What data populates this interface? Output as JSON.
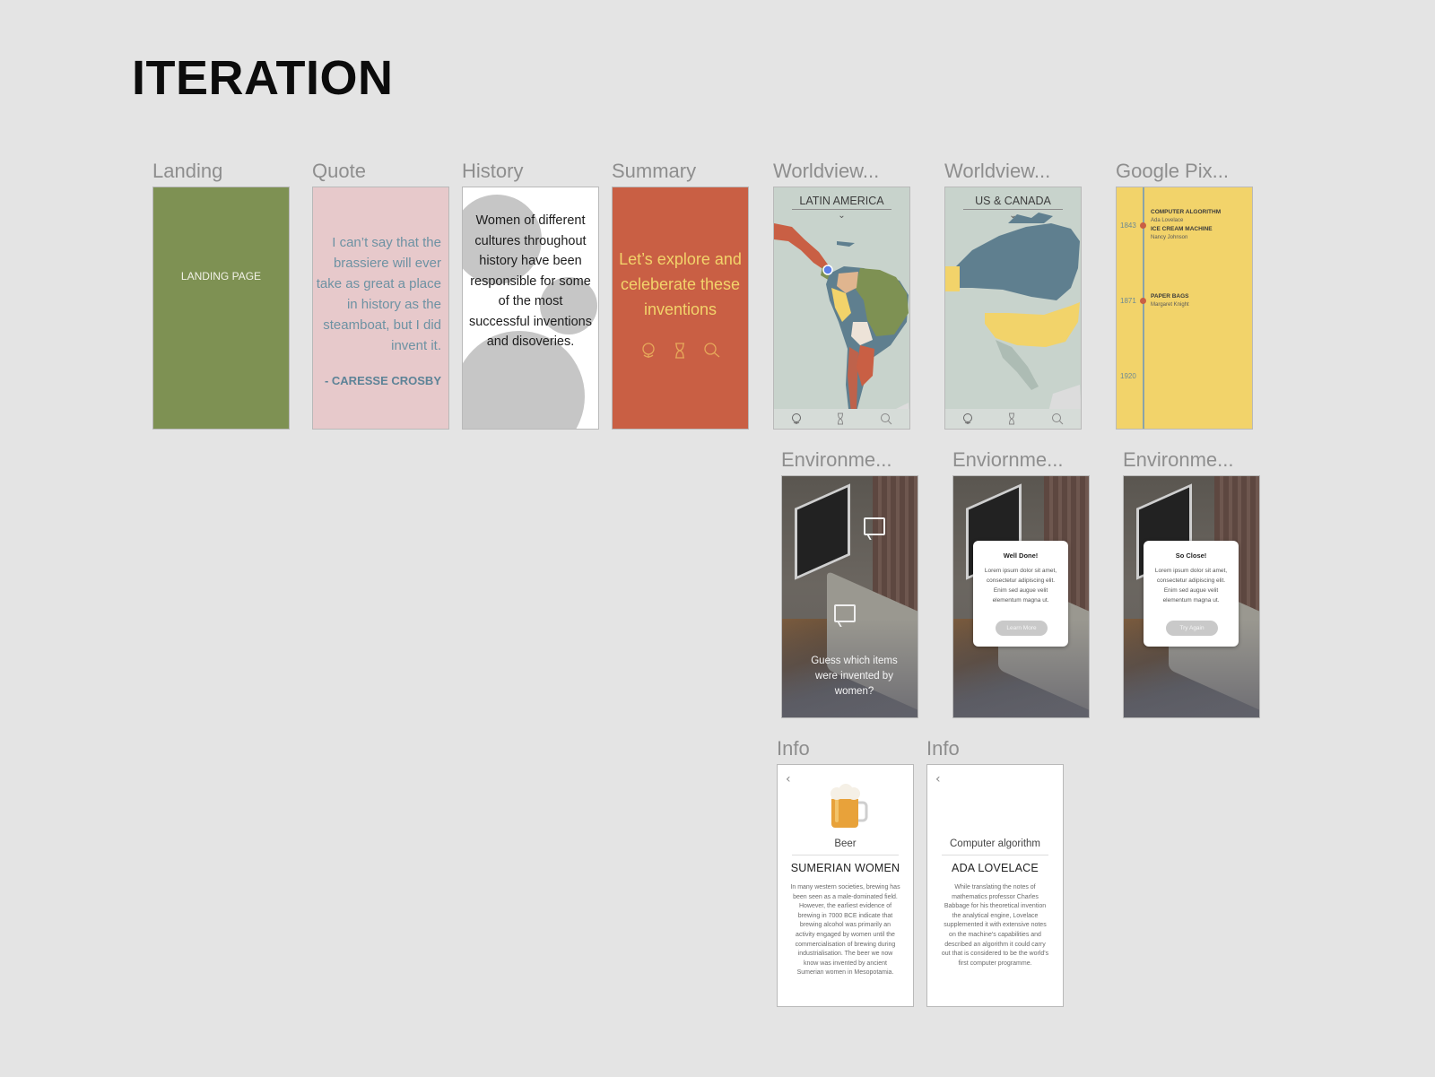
{
  "heading": "ITERATION",
  "frames": {
    "landing": {
      "label": "Landing",
      "text": "LANDING PAGE",
      "color": "#7e9153"
    },
    "quote": {
      "label": "Quote",
      "text": "I can’t say that the brassiere will ever take as great a place in history as the steamboat, but I did invent it.",
      "author": "- CARESSE CROSBY",
      "color": "#e7c9cb"
    },
    "history": {
      "label": "History",
      "text": "Women of different cultures throughout history have been responsible for some of the most successful inventions and disoveries."
    },
    "summary": {
      "label": "Summary",
      "text": "Let’s explore and celeberate these inventions",
      "icons": [
        "globe-icon",
        "hourglass-icon",
        "search-icon"
      ],
      "color": "#c95f44"
    },
    "map_latin": {
      "label": "Worldview...",
      "title": "LATIN AMERICA",
      "chevron": "⌄"
    },
    "map_us": {
      "label": "Worldview...",
      "title": "US & CANADA",
      "chevron": "⌄"
    },
    "timeline": {
      "label": "Google Pix...",
      "events": [
        {
          "year": "1843",
          "heads": [
            "COMPUTER ALGORITHM",
            "ICE CREAM MACHINE"
          ],
          "subs": [
            "Ada Lovelace",
            "Nancy Johnson"
          ]
        },
        {
          "year": "1871",
          "heads": [
            "PAPER BAGS"
          ],
          "subs": [
            "Margaret Knight"
          ]
        },
        {
          "year": "1920",
          "heads": [],
          "subs": []
        }
      ],
      "color": "#f2d36a"
    },
    "env1": {
      "label": "Environme...",
      "prompt": "Guess which items were invented by women?"
    },
    "env2": {
      "label": "Enviornme...",
      "card_title": "Well Done!",
      "card_body": "Lorem ipsum dolor sit amet, consectetur adipiscing elit. Enim sed augue velit elementum magna ut.",
      "button": "Learn More"
    },
    "env3": {
      "label": "Environme...",
      "card_title": "So Close!",
      "card_body": "Lorem ipsum dolor sit amet, consectetur adipiscing elit. Enim sed augue velit elementum magna ut.",
      "button": "Try Again"
    },
    "info1": {
      "label": "Info",
      "back": "‹",
      "item": "Beer",
      "who": "SUMERIAN WOMEN",
      "body": "In many western societies, brewing has been seen as a male-dominated field. However, the earliest evidence of brewing in 7000 BCE indicate that brewing alcohol was primarily an activity engaged by women until the commercialisation of brewing during industrialisation. The beer we now know was invented by ancient Sumerian women in Mesopotamia."
    },
    "info2": {
      "label": "Info",
      "back": "‹",
      "item": "Computer algorithm",
      "who": "ADA LOVELACE",
      "body": "While translating the notes of mathematics professor Charles Babbage for his theoretical invention the analytical engine, Lovelace supplemented it with extensive notes on the machine's capabilities and described an algorithm it could carry out that is considered to be the world's first computer programme."
    }
  }
}
